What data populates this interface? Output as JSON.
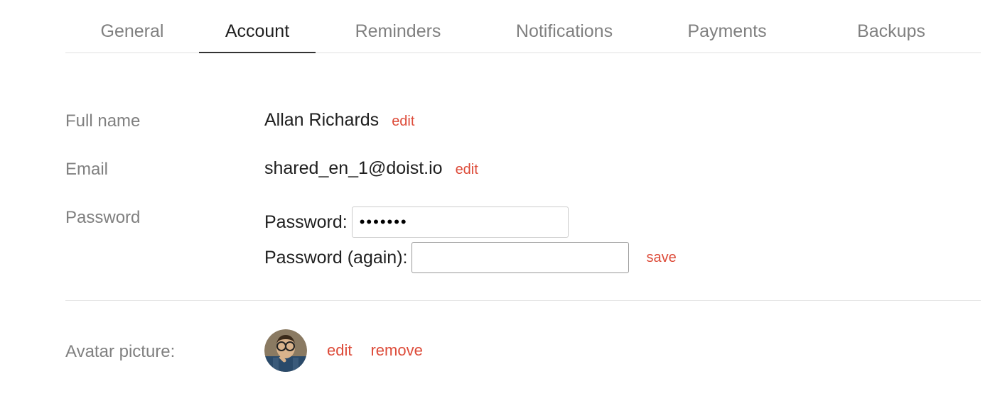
{
  "tabs": {
    "general": "General",
    "account": "Account",
    "reminders": "Reminders",
    "notifications": "Notifications",
    "payments": "Payments",
    "backups": "Backups"
  },
  "fields": {
    "full_name": {
      "label": "Full name",
      "value": "Allan Richards",
      "edit": "edit"
    },
    "email": {
      "label": "Email",
      "value": "shared_en_1@doist.io",
      "edit": "edit"
    },
    "password": {
      "label": "Password",
      "line1_label": "Password:",
      "line1_value": "•••••••",
      "line2_label": "Password (again):",
      "line2_value": "",
      "save": "save"
    },
    "avatar": {
      "label": "Avatar picture:",
      "edit": "edit",
      "remove": "remove"
    }
  }
}
